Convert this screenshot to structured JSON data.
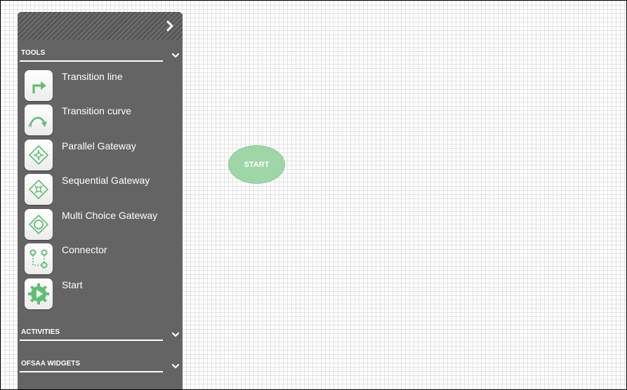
{
  "sidebar": {
    "collapse_icon": "chevron-right-icon",
    "sections": [
      {
        "title": "TOOLS",
        "expanded": true
      },
      {
        "title": "ACTIVITIES",
        "expanded": false
      },
      {
        "title": "OFSAA WIDGETS",
        "expanded": false
      }
    ],
    "tools": [
      {
        "label": "Transition line",
        "icon": "transition-line-icon"
      },
      {
        "label": "Transition curve",
        "icon": "transition-curve-icon"
      },
      {
        "label": "Parallel Gateway",
        "icon": "parallel-gateway-icon"
      },
      {
        "label": "Sequential Gateway",
        "icon": "sequential-gateway-icon"
      },
      {
        "label": "Multi Choice Gateway",
        "icon": "multi-choice-gateway-icon"
      },
      {
        "label": "Connector",
        "icon": "connector-icon"
      },
      {
        "label": "Start",
        "icon": "start-icon"
      }
    ]
  },
  "canvas": {
    "start_node_label": "START"
  },
  "colors": {
    "panel": "#646464",
    "accent_green": "#5fbf72",
    "start_node": "#9fd6a8",
    "grid_line": "#e2e2e2"
  }
}
